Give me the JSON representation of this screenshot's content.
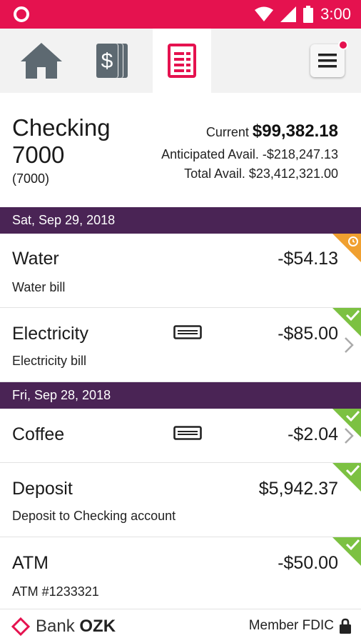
{
  "status_bar": {
    "time": "3:00",
    "color": "#e5124f"
  },
  "nav": {
    "items": [
      {
        "icon": "home-icon",
        "active": false
      },
      {
        "icon": "dollar-cards-icon",
        "active": false
      },
      {
        "icon": "register-icon",
        "active": true
      }
    ],
    "menu_icon": "hamburger-menu-icon",
    "notification_dot": true
  },
  "account": {
    "name": "Checking 7000",
    "number": "(7000)",
    "current_label": "Current",
    "current_value": "$99,382.18",
    "anticipated": "Anticipated Avail. -$218,247.13",
    "total": "Total Avail. $23,412,321.00"
  },
  "groups": [
    {
      "date": "Sat, Sep 29, 2018",
      "transactions": [
        {
          "title": "Water",
          "subtitle": "Water bill",
          "amount": "-$54.13",
          "status": "pending",
          "card": false,
          "chevron": false
        },
        {
          "title": "Electricity",
          "subtitle": "Electricity bill",
          "amount": "-$85.00",
          "status": "cleared",
          "card": true,
          "chevron": true
        }
      ]
    },
    {
      "date": "Fri, Sep 28, 2018",
      "transactions": [
        {
          "title": "Coffee",
          "subtitle": "",
          "amount": "-$2.04",
          "status": "cleared",
          "card": true,
          "chevron": true
        },
        {
          "title": "Deposit",
          "subtitle": "Deposit to Checking account",
          "amount": "$5,942.37",
          "status": "cleared",
          "card": false,
          "chevron": false
        },
        {
          "title": "ATM",
          "subtitle": "ATM #1233321",
          "amount": "-$50.00",
          "status": "cleared",
          "card": false,
          "chevron": false
        }
      ]
    }
  ],
  "footer": {
    "bank_prefix": "Bank",
    "bank_name": "OZK",
    "member": "Member FDIC"
  },
  "colors": {
    "brand_red": "#e5124f",
    "date_header": "#4a2455",
    "cleared_green": "#7cc142",
    "pending_orange": "#f0a030"
  }
}
